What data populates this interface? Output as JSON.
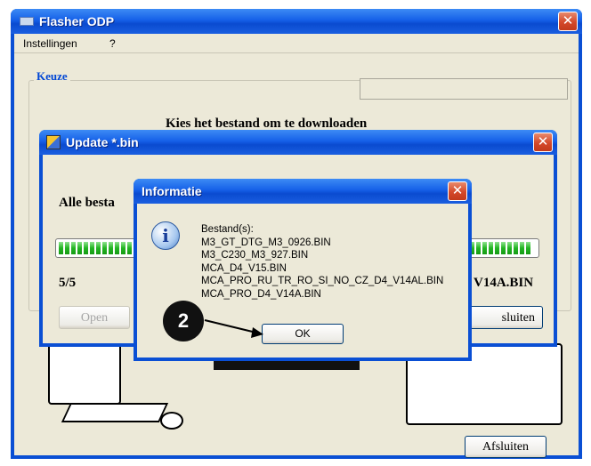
{
  "main_window": {
    "title": "Flasher ODP",
    "menu": [
      "Instellingen",
      "?"
    ],
    "group_label": "Keuze",
    "instruction": "Kies het bestand om te downloaden",
    "right_partial_text": "V14A.BIN",
    "close_button_label": "Afsluiten"
  },
  "update_dialog": {
    "title": "Update *.bin",
    "status_text": "Alle besta",
    "progress_count": "5/5",
    "progress_fraction": 1.0,
    "open_button_label": "Open",
    "close_button_label": "sluiten"
  },
  "info_dialog": {
    "title": "Informatie",
    "heading": "Bestand(s):",
    "files": [
      "M3_GT_DTG_M3_0926.BIN",
      "M3_C230_M3_927.BIN",
      "MCA_D4_V15.BIN",
      "MCA_PRO_RU_TR_RO_SI_NO_CZ_D4_V14AL.BIN",
      "MCA_PRO_D4_V14A.BIN"
    ],
    "ok_label": "OK"
  },
  "callout": {
    "number": "2"
  },
  "colors": {
    "title_bar": "#1560e8",
    "dialog_bg": "#ece9d8",
    "close_red": "#d4482a",
    "progress_green": "#22b522"
  }
}
